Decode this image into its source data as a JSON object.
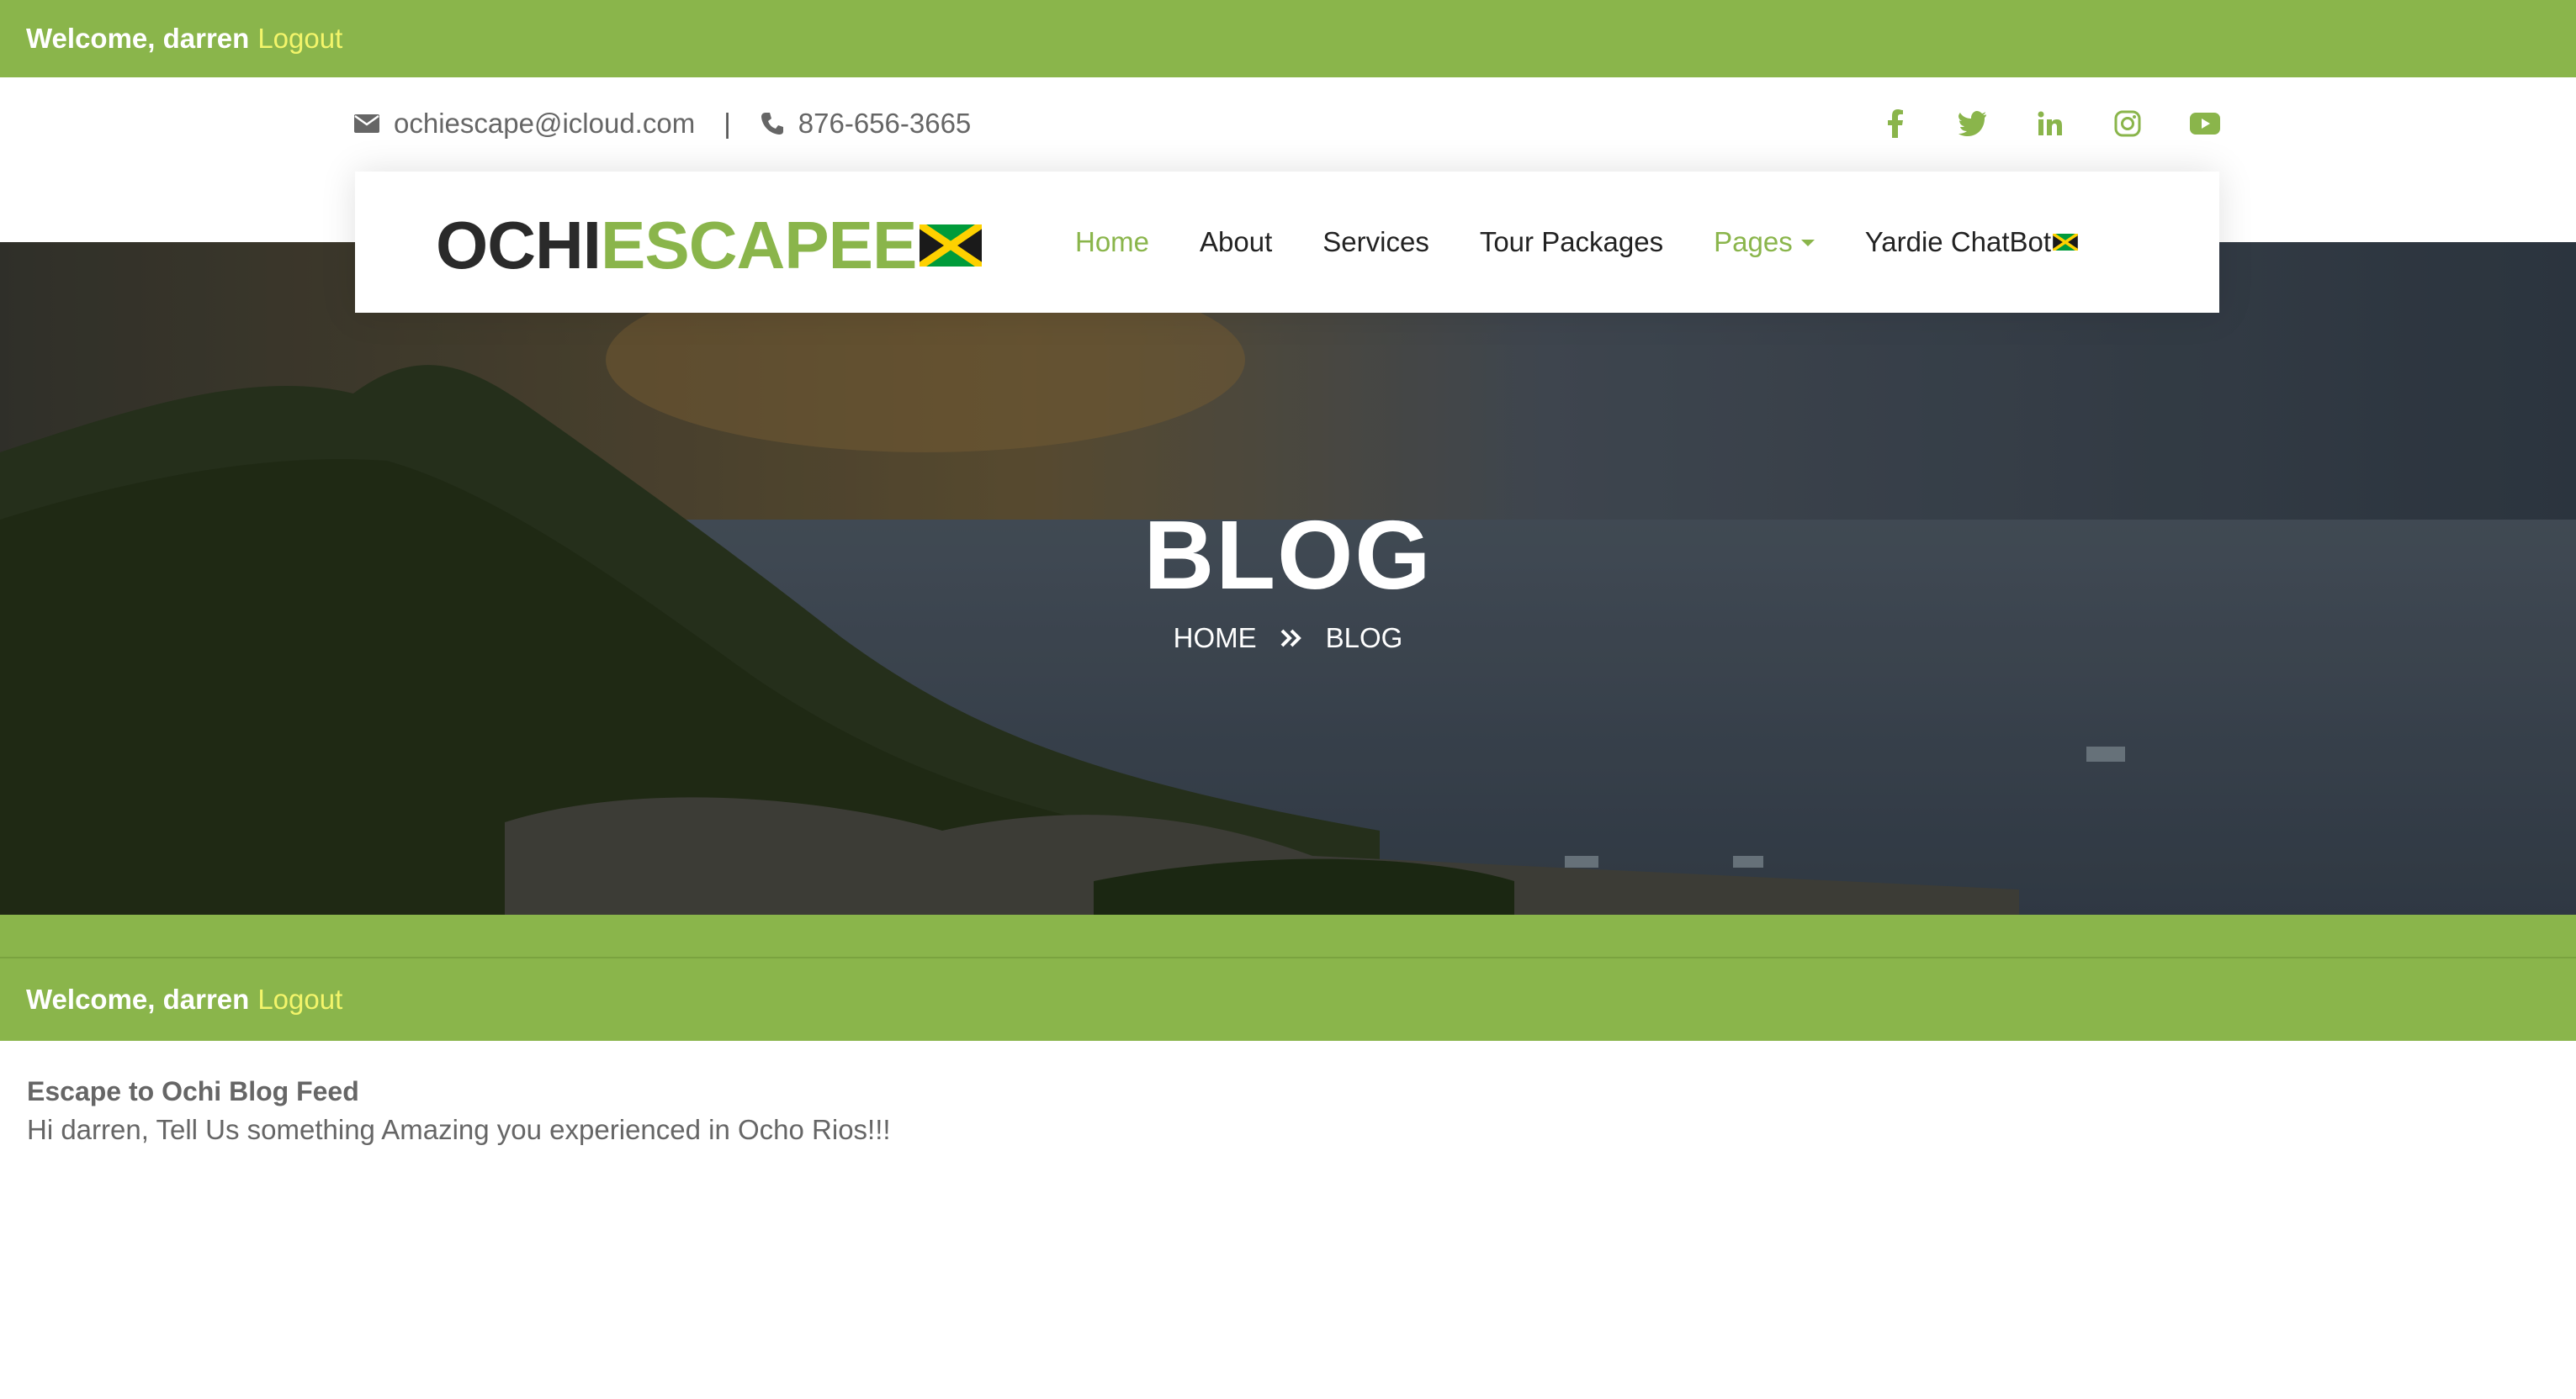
{
  "welcome_bar": {
    "greeting": "Welcome, darren",
    "logout": "Logout"
  },
  "contact": {
    "email": "ochiescape@icloud.com",
    "separator": "|",
    "phone": "876-656-3665"
  },
  "social_icons": [
    "facebook-icon",
    "twitter-icon",
    "linkedin-icon",
    "instagram-icon",
    "youtube-icon"
  ],
  "logo": {
    "part1": "OCHI",
    "part2": "ESCAPEE"
  },
  "nav": {
    "home": "Home",
    "about": "About",
    "services": "Services",
    "tour_packages": "Tour Packages",
    "pages": "Pages",
    "chatbot": "Yardie ChatBot"
  },
  "hero": {
    "title": "BLOG",
    "breadcrumb_home": "HOME",
    "breadcrumb_current": "BLOG"
  },
  "welcome_bar_2": {
    "greeting": "Welcome, darren",
    "logout": "Logout"
  },
  "feed": {
    "title": "Escape to Ochi Blog Feed",
    "subtitle": "Hi darren, Tell Us something Amazing you experienced in Ocho Rios!!!"
  },
  "colors": {
    "accent": "#8ab54b",
    "logout": "#f3f56a",
    "text": "#555555"
  }
}
